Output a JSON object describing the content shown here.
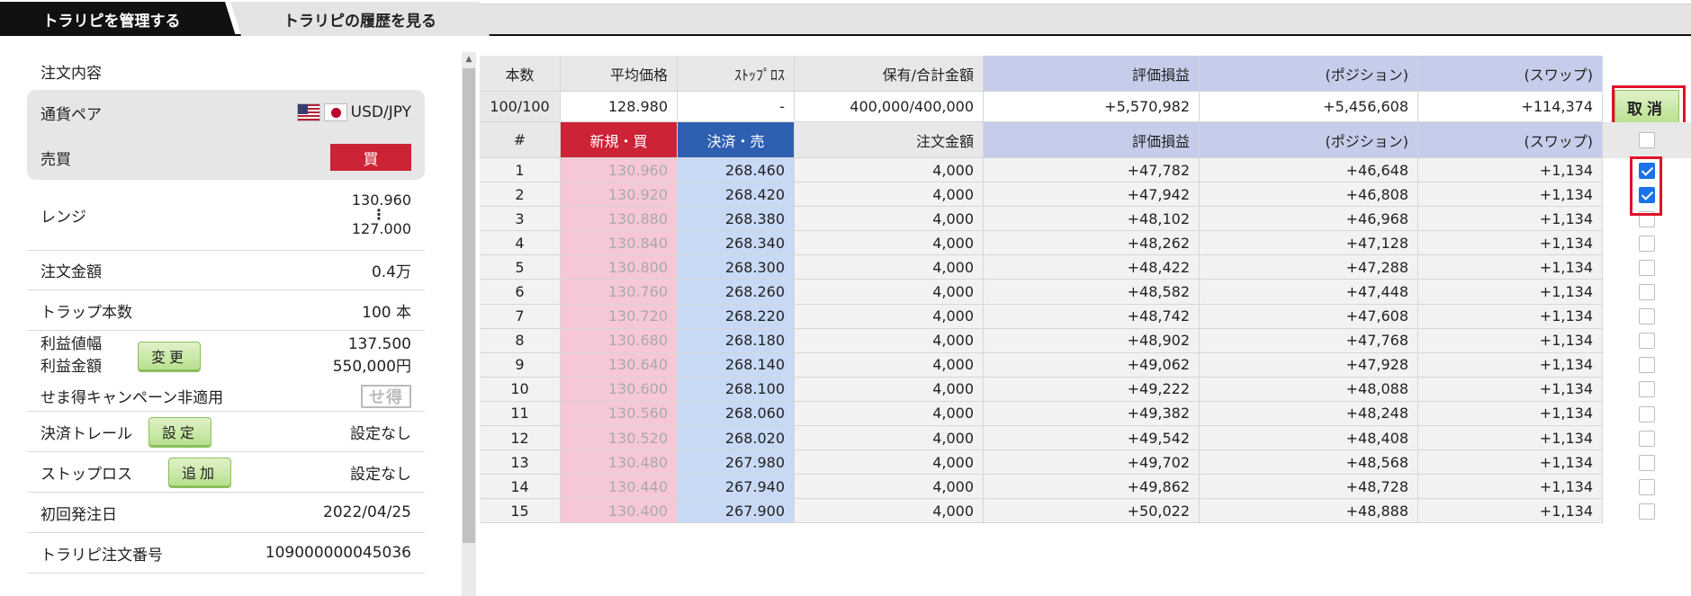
{
  "tabs": [
    {
      "label": "トラリピを管理する"
    },
    {
      "label": "トラリピの履歴を見る"
    }
  ],
  "left": {
    "heading": "注文内容",
    "pair_label": "通貨ペア",
    "pair_value": "USD/JPY",
    "side_label": "売買",
    "side_value": "買",
    "range_label": "レンジ",
    "range_high": "130.960",
    "range_dots": "⋮",
    "range_low": "127.000",
    "order_amount_label": "注文金額",
    "order_amount_value": "0.4万",
    "trap_count_label": "トラップ本数",
    "trap_count_value": "100 本",
    "profit_width_label": "利益値幅",
    "profit_amount_label": "利益金額",
    "change_button": "変更",
    "profit_width_value": "137.500",
    "profit_amount_value": "550,000円",
    "campaign_label": "せま得キャンペーン非適用",
    "campaign_icon_text": "せ得",
    "trail_label": "決済トレール",
    "trail_button": "設定",
    "trail_value": "設定なし",
    "stoploss_label": "ストップロス",
    "stoploss_button": "追加",
    "stoploss_value": "設定なし",
    "first_order_label": "初回発注日",
    "first_order_value": "2022/04/25",
    "order_no_label": "トラリピ注文番号",
    "order_no_value": "109000000045036"
  },
  "summary": {
    "headers": {
      "count": "本数",
      "avg_price": "平均価格",
      "stoploss": "ｽﾄｯﾌﾟﾛｽ",
      "holding": "保有/合計金額",
      "pl": "評価損益",
      "position": "(ポジション)",
      "swap": "(スワップ)"
    },
    "values": {
      "count": "100/100",
      "avg_price": "128.980",
      "stoploss": "-",
      "holding": "400,000/400,000",
      "pl": "+5,570,982",
      "position": "+5,456,608",
      "swap": "+114,374"
    },
    "cancel_button": "取消"
  },
  "table": {
    "headers": {
      "num": "#",
      "new": "新規・買",
      "settle": "決済・売",
      "amount": "注文金額",
      "pl": "評価損益",
      "position": "(ポジション)",
      "swap": "(スワップ)"
    },
    "rows": [
      {
        "num": "1",
        "new": "130.960",
        "settle": "268.460",
        "amount": "4,000",
        "pl": "+47,782",
        "position": "+46,648",
        "swap": "+1,134",
        "checked": true
      },
      {
        "num": "2",
        "new": "130.920",
        "settle": "268.420",
        "amount": "4,000",
        "pl": "+47,942",
        "position": "+46,808",
        "swap": "+1,134",
        "checked": true
      },
      {
        "num": "3",
        "new": "130.880",
        "settle": "268.380",
        "amount": "4,000",
        "pl": "+48,102",
        "position": "+46,968",
        "swap": "+1,134",
        "checked": false
      },
      {
        "num": "4",
        "new": "130.840",
        "settle": "268.340",
        "amount": "4,000",
        "pl": "+48,262",
        "position": "+47,128",
        "swap": "+1,134",
        "checked": false
      },
      {
        "num": "5",
        "new": "130.800",
        "settle": "268.300",
        "amount": "4,000",
        "pl": "+48,422",
        "position": "+47,288",
        "swap": "+1,134",
        "checked": false
      },
      {
        "num": "6",
        "new": "130.760",
        "settle": "268.260",
        "amount": "4,000",
        "pl": "+48,582",
        "position": "+47,448",
        "swap": "+1,134",
        "checked": false
      },
      {
        "num": "7",
        "new": "130.720",
        "settle": "268.220",
        "amount": "4,000",
        "pl": "+48,742",
        "position": "+47,608",
        "swap": "+1,134",
        "checked": false
      },
      {
        "num": "8",
        "new": "130.680",
        "settle": "268.180",
        "amount": "4,000",
        "pl": "+48,902",
        "position": "+47,768",
        "swap": "+1,134",
        "checked": false
      },
      {
        "num": "9",
        "new": "130.640",
        "settle": "268.140",
        "amount": "4,000",
        "pl": "+49,062",
        "position": "+47,928",
        "swap": "+1,134",
        "checked": false
      },
      {
        "num": "10",
        "new": "130.600",
        "settle": "268.100",
        "amount": "4,000",
        "pl": "+49,222",
        "position": "+48,088",
        "swap": "+1,134",
        "checked": false
      },
      {
        "num": "11",
        "new": "130.560",
        "settle": "268.060",
        "amount": "4,000",
        "pl": "+49,382",
        "position": "+48,248",
        "swap": "+1,134",
        "checked": false
      },
      {
        "num": "12",
        "new": "130.520",
        "settle": "268.020",
        "amount": "4,000",
        "pl": "+49,542",
        "position": "+48,408",
        "swap": "+1,134",
        "checked": false
      },
      {
        "num": "13",
        "new": "130.480",
        "settle": "267.980",
        "amount": "4,000",
        "pl": "+49,702",
        "position": "+48,568",
        "swap": "+1,134",
        "checked": false
      },
      {
        "num": "14",
        "new": "130.440",
        "settle": "267.940",
        "amount": "4,000",
        "pl": "+49,862",
        "position": "+48,728",
        "swap": "+1,134",
        "checked": false
      },
      {
        "num": "15",
        "new": "130.400",
        "settle": "267.900",
        "amount": "4,000",
        "pl": "+50,022",
        "position": "+48,888",
        "swap": "+1,134",
        "checked": false
      }
    ]
  },
  "colors": {
    "buy_red": "#cc2336",
    "sell_blue": "#2f5fb1",
    "pl_header_blue": "#c6cdea",
    "check_blue": "#1a73e8",
    "highlight_red": "#e0112b"
  }
}
